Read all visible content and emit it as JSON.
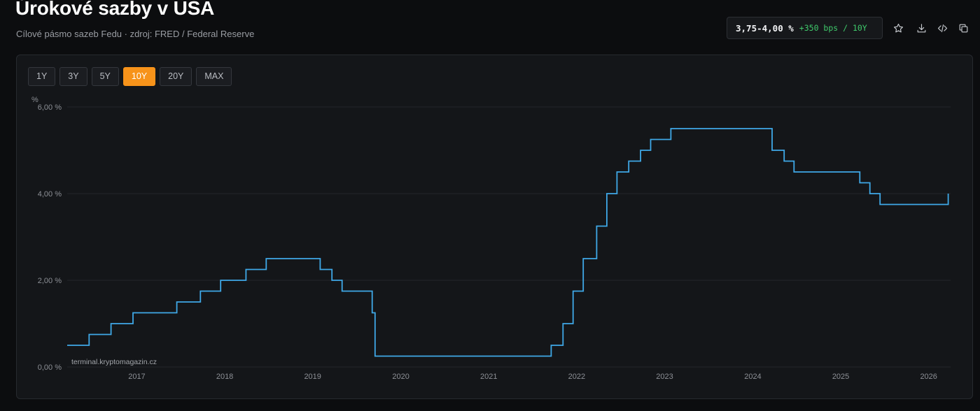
{
  "header": {
    "title": "Úrokové sazby v USA",
    "subtitle": "Cílové pásmo sazeb Fedu · zdroj: FRED / Federal Reserve"
  },
  "rate_box": {
    "value": "3,75-4,00 %",
    "change": "+350 bps / 10Y"
  },
  "toolbar": {
    "icons": [
      "star-icon",
      "download-icon",
      "code-icon",
      "copy-icon"
    ]
  },
  "range_buttons": {
    "items": [
      "1Y",
      "3Y",
      "5Y",
      "10Y",
      "20Y",
      "MAX"
    ],
    "active": "10Y",
    "active_color": "#f7931a"
  },
  "watermark": "terminal.kryptomagazin.cz",
  "colors": {
    "line": "#3fa9e8",
    "background": "#0c0d0f",
    "panel": "#141619",
    "positive": "#3fc96b"
  },
  "chart_data": {
    "type": "line",
    "title": "",
    "xlabel": "",
    "ylabel": "%",
    "ylim": [
      0,
      6
    ],
    "xlim": [
      "2016-09-15",
      "2026-09-30"
    ],
    "y_ticks": [
      "0,00 %",
      "2,00 %",
      "4,00 %",
      "6,00 %"
    ],
    "y_tick_values": [
      0,
      2,
      4,
      6
    ],
    "x_ticks": [
      "2017",
      "2018",
      "2019",
      "2020",
      "2021",
      "2022",
      "2023",
      "2024",
      "2025",
      "2026"
    ],
    "grid": true,
    "series": [
      {
        "step": true,
        "points": [
          [
            "2016-09-15",
            0.5
          ],
          [
            "2016-12-15",
            0.75
          ],
          [
            "2017-03-16",
            1.0
          ],
          [
            "2017-06-15",
            1.25
          ],
          [
            "2017-12-14",
            1.5
          ],
          [
            "2018-03-22",
            1.75
          ],
          [
            "2018-06-14",
            2.0
          ],
          [
            "2018-09-27",
            2.25
          ],
          [
            "2018-12-20",
            2.5
          ],
          [
            "2019-08-01",
            2.25
          ],
          [
            "2019-09-19",
            2.0
          ],
          [
            "2019-10-31",
            1.75
          ],
          [
            "2020-03-04",
            1.25
          ],
          [
            "2020-03-16",
            0.25
          ],
          [
            "2022-03-17",
            0.5
          ],
          [
            "2022-05-05",
            1.0
          ],
          [
            "2022-06-16",
            1.75
          ],
          [
            "2022-07-28",
            2.5
          ],
          [
            "2022-09-22",
            3.25
          ],
          [
            "2022-11-03",
            4.0
          ],
          [
            "2022-12-15",
            4.5
          ],
          [
            "2023-02-02",
            4.75
          ],
          [
            "2023-03-23",
            5.0
          ],
          [
            "2023-05-04",
            5.25
          ],
          [
            "2023-07-27",
            5.5
          ],
          [
            "2024-09-19",
            5.0
          ],
          [
            "2024-11-08",
            4.75
          ],
          [
            "2024-12-19",
            4.5
          ],
          [
            "2025-09-18",
            4.25
          ],
          [
            "2025-10-30",
            4.0
          ],
          [
            "2025-12-11",
            3.75
          ],
          [
            "2026-09-20",
            4.0
          ]
        ]
      }
    ]
  }
}
